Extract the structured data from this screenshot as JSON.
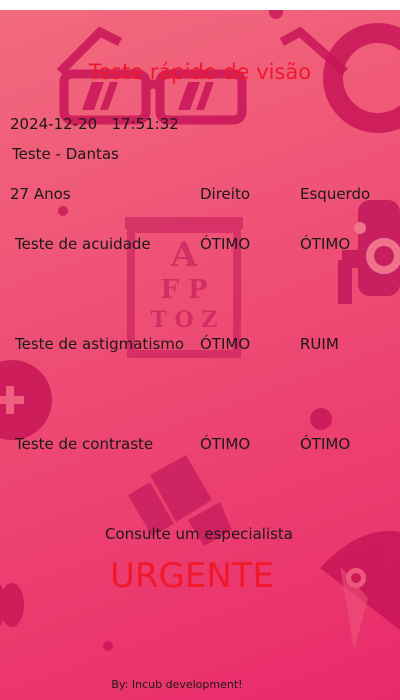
{
  "title": "Teste rápido de visão",
  "datetime": "2024-12-20   17:51:32",
  "test_name": "Teste - Dantas",
  "header": {
    "age": "27 Anos",
    "right_eye": "Direito",
    "left_eye": "Esquerdo"
  },
  "results": [
    {
      "test": "Teste de acuidade",
      "right": "ÓTIMO",
      "left": "ÓTIMO"
    },
    {
      "test": "Teste de astigmatismo",
      "right": "ÓTIMO",
      "left": "RUIM"
    },
    {
      "test": "Teste de contraste",
      "right": "ÓTIMO",
      "left": "ÓTIMO"
    }
  ],
  "recommendation": "Consulte um especialista",
  "urgency": "URGENTE",
  "credit": "By: Incub development!",
  "eye_chart_letters": [
    "A",
    "F P",
    "T O Z"
  ],
  "colors": {
    "background_top": "#f26a7e",
    "background_bottom": "#e92a6a",
    "accent_red": "#f0192b",
    "decor": "#d81b60"
  }
}
